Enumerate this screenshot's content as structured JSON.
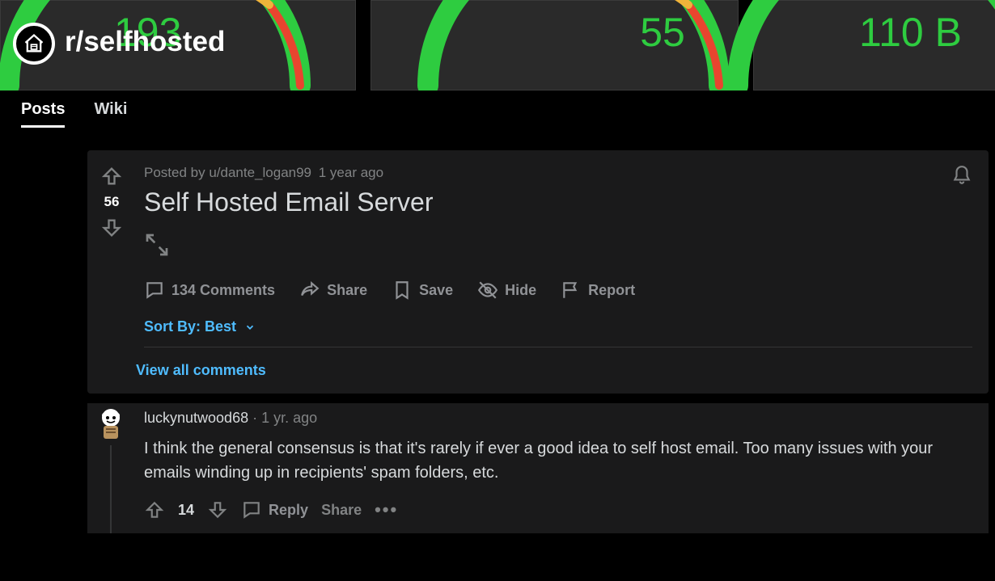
{
  "banner": {
    "gauges": [
      {
        "value": "193"
      },
      {
        "value": "55"
      },
      {
        "value": "110 B"
      }
    ]
  },
  "subreddit": {
    "name": "r/selfhosted"
  },
  "tabs": {
    "posts": "Posts",
    "wiki": "Wiki"
  },
  "post": {
    "posted_by_prefix": "Posted by ",
    "author": "u/dante_logan99",
    "age": "1 year ago",
    "score": "56",
    "title": "Self Hosted Email Server",
    "actions": {
      "comments": "134 Comments",
      "share": "Share",
      "save": "Save",
      "hide": "Hide",
      "report": "Report"
    },
    "sort_label": "Sort By: Best",
    "view_all": "View all comments"
  },
  "comment": {
    "author": "luckynutwood68",
    "sep": " · ",
    "age": "1 yr. ago",
    "body": "I think the general consensus is that it's rarely if ever a good idea to self host email. Too many issues with your emails winding up in recipients' spam folders, etc.",
    "score": "14",
    "reply": "Reply",
    "share": "Share"
  }
}
